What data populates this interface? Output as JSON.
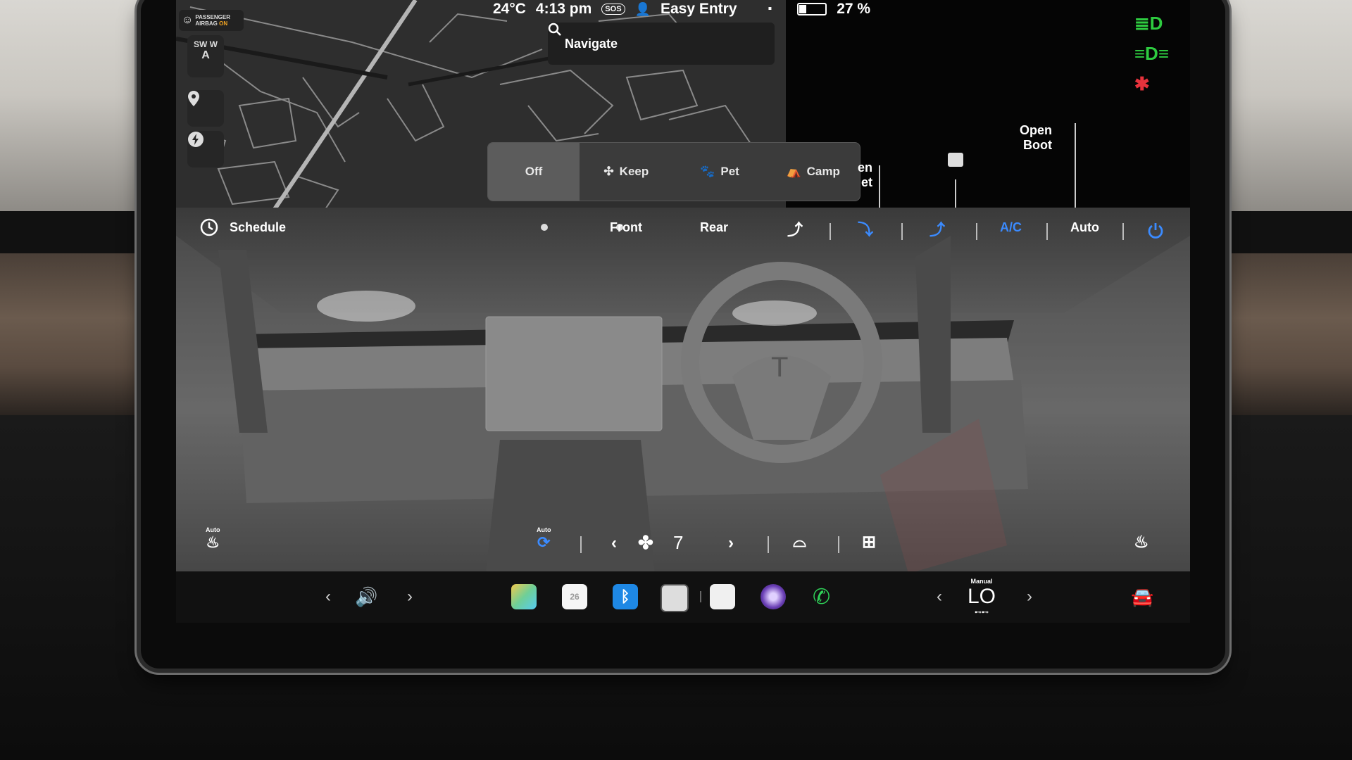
{
  "status": {
    "temperature": "24°C",
    "time": "4:13 pm",
    "sos_label": "SOS",
    "easy_entry": "Easy Entry",
    "battery_percent": "27 %"
  },
  "airbag": {
    "line1": "PASSENGER",
    "line2_prefix": "AIRBAG",
    "line2_status": "ON"
  },
  "compass": {
    "heading_a": "SW",
    "heading_b": "W",
    "arrow": "A"
  },
  "search": {
    "placeholder": "Navigate"
  },
  "modes": [
    {
      "label": "Off",
      "active": true
    },
    {
      "label": "Keep",
      "active": false
    },
    {
      "label": "Pet",
      "active": false
    },
    {
      "label": "Camp",
      "active": false
    }
  ],
  "doors": {
    "open_frunk_partial_1": "en",
    "open_frunk_partial_2": "et",
    "open_boot_line1": "Open",
    "open_boot_line2": "Boot"
  },
  "climate": {
    "schedule": "Schedule",
    "front": "Front",
    "rear": "Rear",
    "ac": "A/C",
    "auto": "Auto",
    "seat_left_auto": "Auto",
    "recirc_auto": "Auto",
    "fan_speed": "7"
  },
  "dock": {
    "temp_mode": "Manual",
    "temp_value": "LO",
    "calendar_day": "26"
  },
  "colors": {
    "accent_blue": "#3b8bff",
    "indicator_green": "#2ecc40",
    "indicator_red": "#e8323c",
    "phone_green": "#2fd158",
    "airbag_on": "#f5a623"
  }
}
